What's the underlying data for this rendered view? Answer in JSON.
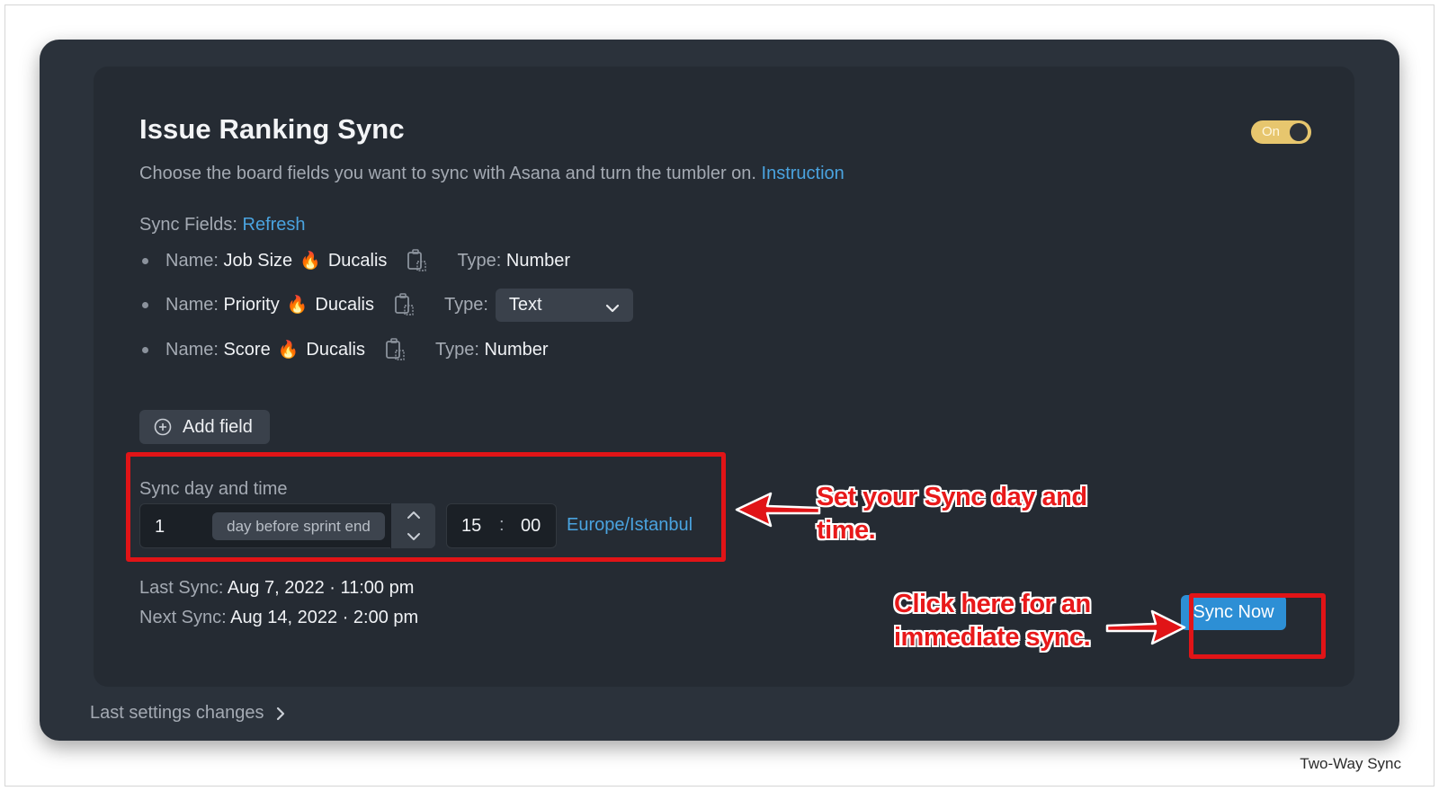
{
  "card": {
    "title": "Issue Ranking Sync",
    "toggle_label": "On",
    "description": "Choose the board fields you want to sync with Asana and turn the tumbler on.",
    "instruction_link": "Instruction"
  },
  "sync_fields": {
    "label": "Sync Fields:",
    "refresh_link": "Refresh",
    "name_label": "Name:",
    "type_label": "Type:",
    "flame": "🔥",
    "items": [
      {
        "name": "Job Size",
        "source": "Ducalis",
        "type": "Number"
      },
      {
        "name": "Priority",
        "source": "Ducalis",
        "type": "Text"
      },
      {
        "name": "Score",
        "source": "Ducalis",
        "type": "Number"
      }
    ],
    "add_field_label": "Add field"
  },
  "sync_day_time": {
    "label": "Sync day and time",
    "day_value": "1",
    "day_suffix": "day before sprint end",
    "hour": "15",
    "separator": ":",
    "minute": "00",
    "timezone": "Europe/Istanbul"
  },
  "sync_status": {
    "last_label": "Last Sync:",
    "last_value": "Aug 7, 2022 · 11:00 pm",
    "next_label": "Next Sync:",
    "next_value": "Aug 14, 2022 · 2:00 pm"
  },
  "sync_now_label": "Sync Now",
  "last_settings_changes": "Last settings changes",
  "annotations": {
    "day_time_line1": "Set your Sync day and",
    "day_time_line2": "time.",
    "sync_now_line1": "Click here for an",
    "sync_now_line2": "immediate sync."
  },
  "watermark": "Two-Way Sync",
  "colors": {
    "panel_bg": "#2b323b",
    "card_bg": "#252b33",
    "accent_link": "#4aa3df",
    "toggle_on": "#e7c66e",
    "primary_button": "#2d8fd5",
    "annotation_red": "#e11417"
  },
  "icons": [
    "copy-icon",
    "chevron-down-icon",
    "plus-circle-icon",
    "chevron-up-icon",
    "chevron-right-icon",
    "arrow-left-icon"
  ]
}
